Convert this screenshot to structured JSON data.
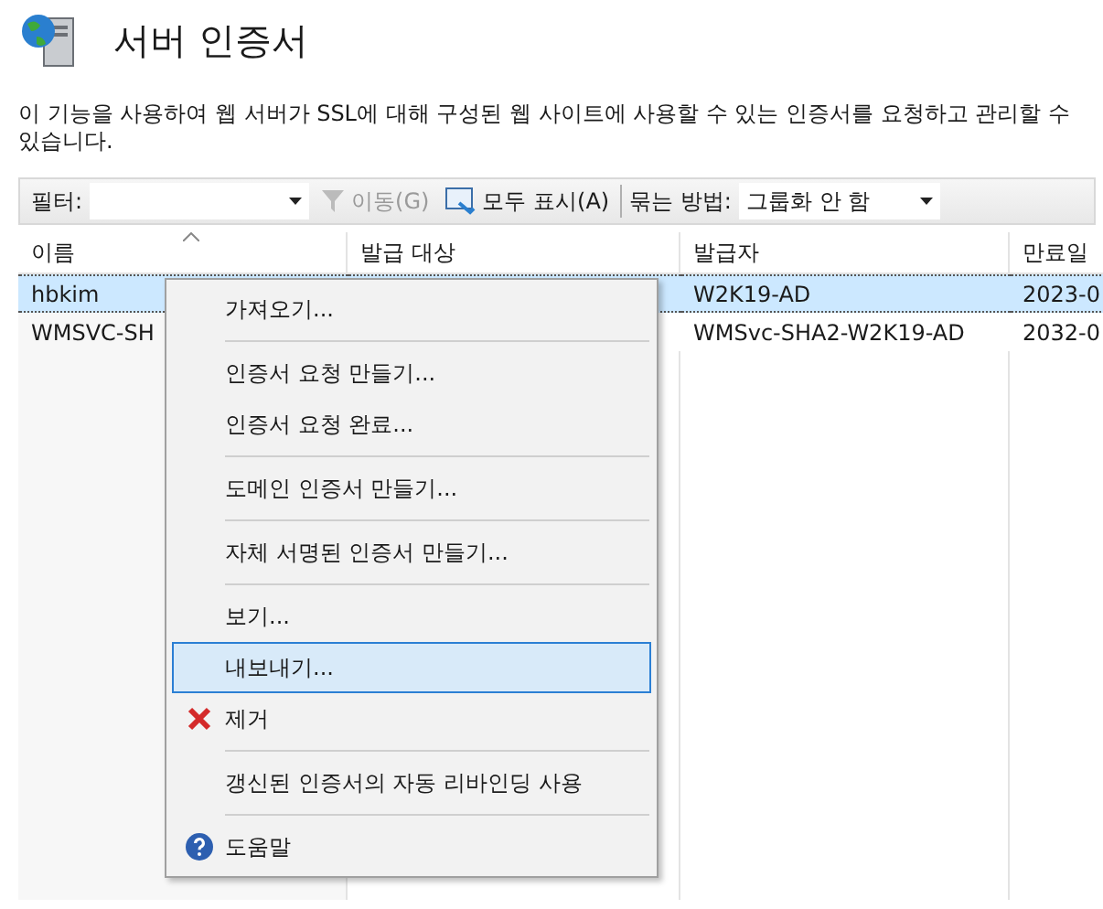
{
  "header": {
    "title": "서버 인증서",
    "description": "이 기능을 사용하여 웹 서버가 SSL에 대해 구성된 웹 사이트에 사용할 수 있는 인증서를 요청하고 관리할 수 있습니다."
  },
  "toolbar": {
    "filter_label": "필터:",
    "go_button": {
      "label": "이동(G)",
      "disabled": true
    },
    "show_all_button": {
      "label": "모두 표시(A)",
      "disabled": false
    },
    "group_label": "묶는 방법:",
    "group_value": "그룹화 안 함"
  },
  "table": {
    "columns": [
      {
        "label": "이름",
        "sorted": true
      },
      {
        "label": "발급 대상",
        "sorted": false
      },
      {
        "label": "발급자",
        "sorted": false
      },
      {
        "label": "만료일",
        "sorted": false
      }
    ],
    "rows": [
      {
        "selected": true,
        "cells": [
          "hbkim",
          "",
          "W2K19-AD",
          "2023-0"
        ]
      },
      {
        "selected": false,
        "cells": [
          "WMSVC-SH",
          "",
          "WMSvc-SHA2-W2K19-AD",
          "2032-0"
        ]
      }
    ]
  },
  "context_menu": [
    {
      "kind": "item",
      "label": "가져오기...",
      "selected": false
    },
    {
      "kind": "separator"
    },
    {
      "kind": "item",
      "label": "인증서 요청 만들기...",
      "selected": false
    },
    {
      "kind": "item",
      "label": "인증서 요청 완료...",
      "selected": false
    },
    {
      "kind": "separator"
    },
    {
      "kind": "item",
      "label": "도메인 인증서 만들기...",
      "selected": false
    },
    {
      "kind": "separator"
    },
    {
      "kind": "item",
      "label": "자체 서명된 인증서 만들기...",
      "selected": false
    },
    {
      "kind": "separator"
    },
    {
      "kind": "item",
      "label": "보기...",
      "selected": false
    },
    {
      "kind": "item",
      "label": "내보내기...",
      "selected": true
    },
    {
      "kind": "remove",
      "label": "제거",
      "selected": false
    },
    {
      "kind": "separator"
    },
    {
      "kind": "item",
      "label": "갱신된 인증서의 자동 리바인딩 사용",
      "selected": false
    },
    {
      "kind": "separator"
    },
    {
      "kind": "help",
      "label": "도움말",
      "selected": false
    }
  ]
}
